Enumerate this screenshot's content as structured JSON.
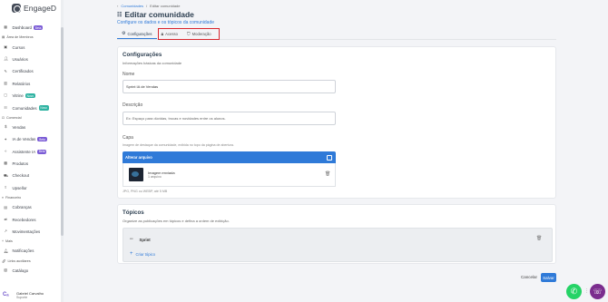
{
  "app": {
    "name": "EngageD"
  },
  "sidebar": {
    "items": [
      {
        "label": "Dashboard",
        "icon": "grid-icon",
        "badge": "Beta",
        "type": "item"
      },
      {
        "label": "Área de Membros",
        "icon": "book-icon",
        "type": "section"
      },
      {
        "label": "Cursos",
        "icon": "course-icon",
        "type": "item"
      },
      {
        "label": "Usuários",
        "icon": "users-icon",
        "type": "item"
      },
      {
        "label": "Certificados",
        "icon": "certificate-icon",
        "type": "item"
      },
      {
        "label": "Relatórios",
        "icon": "report-icon",
        "type": "item"
      },
      {
        "label": "Vitrine",
        "icon": "store-icon",
        "badge": "Novo",
        "type": "item"
      },
      {
        "label": "Comunidades",
        "icon": "community-icon",
        "badge": "Novo",
        "type": "item"
      },
      {
        "label": "Comercial",
        "icon": "cart-icon",
        "type": "section"
      },
      {
        "label": "Vendas",
        "icon": "dollar-icon",
        "type": "item"
      },
      {
        "label": "IA de Vendas",
        "icon": "ai-icon",
        "badge": "Beta",
        "type": "item"
      },
      {
        "label": "Assistente IA",
        "icon": "assistant-icon",
        "badge": "Beta",
        "type": "item"
      },
      {
        "label": "Produtos",
        "icon": "box-icon",
        "type": "item"
      },
      {
        "label": "Checkout",
        "icon": "checkout-icon",
        "type": "item"
      },
      {
        "label": "Upsellor",
        "icon": "upsell-icon",
        "type": "item"
      },
      {
        "label": "Financeiro",
        "icon": "money-icon",
        "type": "section"
      },
      {
        "label": "Cobranças",
        "icon": "invoice-icon",
        "type": "item"
      },
      {
        "label": "Recebedores",
        "icon": "receiver-icon",
        "type": "item"
      },
      {
        "label": "Movimentações",
        "icon": "chart-icon",
        "type": "item"
      },
      {
        "label": "Mais",
        "icon": "plus-icon",
        "type": "section"
      },
      {
        "label": "Notificações",
        "icon": "bell-icon",
        "type": "item"
      },
      {
        "label": "Links auxiliares",
        "icon": "link-icon",
        "type": "section"
      },
      {
        "label": "Catálogo",
        "icon": "catalog-icon",
        "type": "item"
      }
    ],
    "user": {
      "name": "Gabriel Carvalho",
      "role": "Suporte"
    }
  },
  "breadcrumb": {
    "back": "Comunidades",
    "separator": "/",
    "current": "Editar comunidade"
  },
  "page": {
    "title": "Editar comunidade",
    "subtitle": "Configure os dados e os tópicos da comunidade"
  },
  "tabs": [
    {
      "label": "Configurações",
      "icon": "gear-icon",
      "active": true
    },
    {
      "label": "Acesso",
      "icon": "lock-icon",
      "active": false
    },
    {
      "label": "Moderação",
      "icon": "shield-icon",
      "active": false
    }
  ],
  "settings": {
    "title": "Configurações",
    "subtitle": "Informações básicas da comunidade",
    "name_label": "Nome",
    "name_value": "Sprint IA de Vendas",
    "description_label": "Descrição",
    "description_placeholder": "Ex: Espaço para dúvidas, trocas e novidades entre os alunos.",
    "cover_label": "Capa",
    "cover_hint": "Imagem de destaque da comunidade, exibida no topo da página de abertura.",
    "upload_header": "Alterar arquivo",
    "file_name": "Imagem enviada",
    "file_size": "1 arquivo",
    "formats_hint": "JPG, PNG ou WEBP, até 5 MB"
  },
  "topics": {
    "title": "Tópicos",
    "subtitle": "Organize as publicações em tópicos e defina a ordem de exibição.",
    "items": [
      {
        "name": "Sprint"
      }
    ],
    "create_label": "Criar tópico"
  },
  "actions": {
    "cancel": "Cancelar",
    "save": "Salvar"
  },
  "colors": {
    "accent": "#2f7ad8",
    "highlight": "#d9262e",
    "whatsapp": "#25d366",
    "chat": "#7b2d8e"
  }
}
